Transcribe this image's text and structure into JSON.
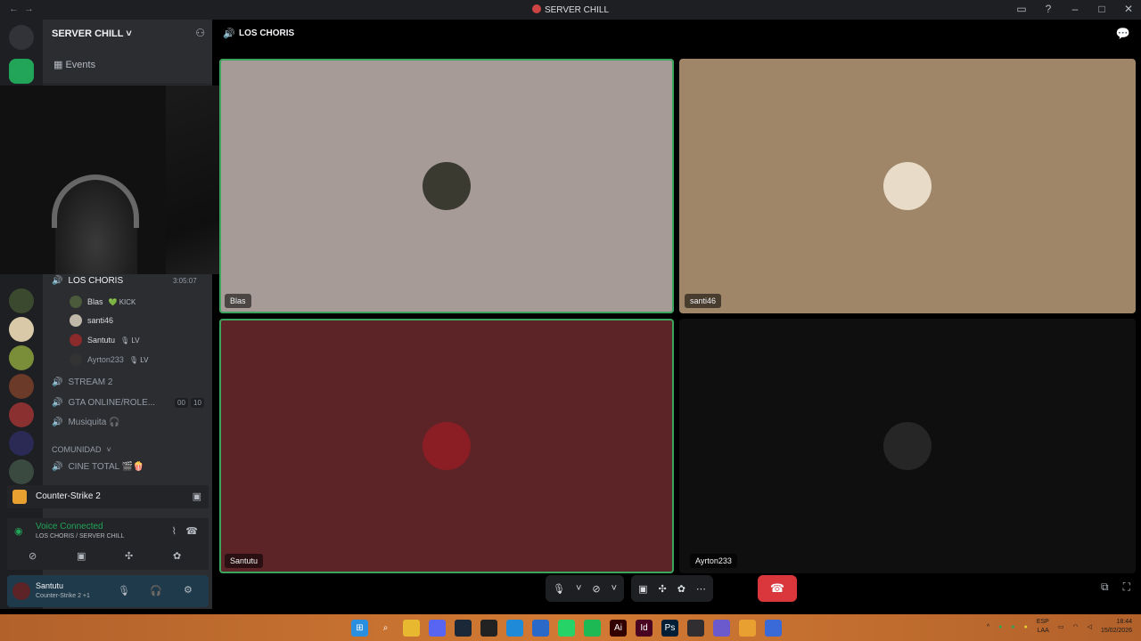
{
  "window": {
    "title": "SERVER CHILL",
    "nav_back": "←",
    "nav_forward": "→",
    "icons": [
      "inbox-icon",
      "help-icon",
      "minimize-icon",
      "maximize-icon",
      "close-icon"
    ]
  },
  "sidebar": {
    "server_name": "SERVER CHILL ˅",
    "events_label": "Events",
    "channels": [
      {
        "name": "LOS CHORIS",
        "timer": "3:05:07",
        "active": true
      },
      {
        "name": "STREAM 2"
      },
      {
        "name": "GTA ONLINE/ROLE...",
        "count_a": "00",
        "count_b": "10"
      },
      {
        "name": "Musiquita 🎧"
      },
      {
        "name": "CINE TOTAL 🎬🍿"
      }
    ],
    "category": "COMUNIDAD",
    "voice_users": [
      {
        "name": "Blas",
        "tag": "💚 KICK"
      },
      {
        "name": "santi46",
        "tag": ""
      },
      {
        "name": "Santutu",
        "tag": "🎙 LV"
      },
      {
        "name": "Ayrton233",
        "tag": "🎙 LV"
      }
    ]
  },
  "game_activity": {
    "title": "Counter-Strike 2"
  },
  "voice_status": {
    "title": "Voice Connected",
    "subtitle": "LOS CHORIS / SERVER CHILL"
  },
  "user_panel": {
    "name": "Santutu",
    "status": "Counter-Strike 2 +1"
  },
  "call": {
    "channel_name": "LOS CHORIS",
    "participants": [
      {
        "name": "Blas",
        "speaking": true,
        "bg": "#a79b97"
      },
      {
        "name": "santi46",
        "speaking": false,
        "bg": "#9f8668"
      },
      {
        "name": "Santutu",
        "speaking": true,
        "bg": "#5d2428"
      },
      {
        "name": "Ayrton233",
        "speaking": false,
        "bg": "#0f0f0f"
      }
    ]
  },
  "taskbar": {
    "lang_top": "ESP",
    "lang_bottom": "LAA",
    "time": "18:44",
    "date": "15/02/2026"
  },
  "colors": {
    "accent_green": "#3ba55d",
    "hangup_red": "#da373c"
  }
}
